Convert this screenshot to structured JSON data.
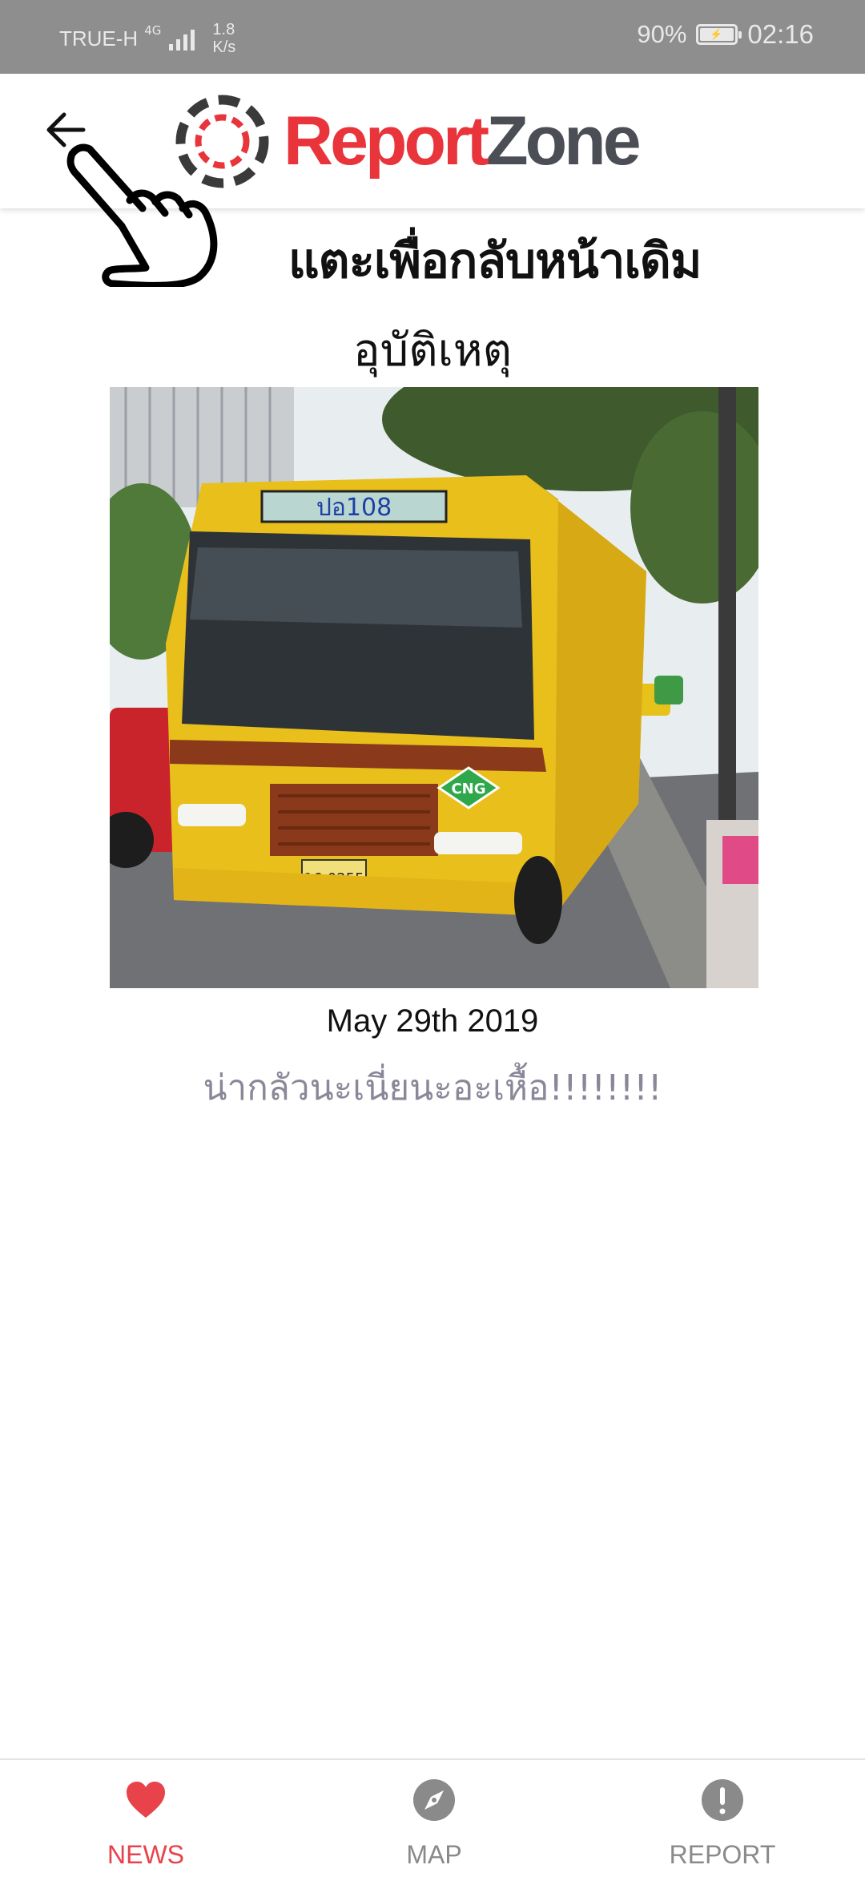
{
  "status_bar": {
    "carrier": "TRUE-H",
    "network": "4G",
    "speed_value": "1.8",
    "speed_unit": "K/s",
    "battery": "90%",
    "time": "02:16"
  },
  "header": {
    "logo_part1": "Report",
    "logo_part2": "Zone",
    "back_icon": "back-arrow-icon"
  },
  "hint": {
    "text": "แตะเพื่อกลับหน้าเดิม",
    "icon": "tap-hand-icon"
  },
  "news": {
    "title": "อุบัติเหตุ",
    "date": "May 29th 2019",
    "description": "น่ากลัวนะเนี่ยนะอะเหื้อ!!!!!!!!",
    "photo": {
      "route_sign": "ปอ108",
      "plate": "16-0255",
      "fuel_badge": "CNG"
    }
  },
  "bottom_nav": {
    "items": [
      {
        "label": "NEWS",
        "icon": "heart-icon",
        "active": true
      },
      {
        "label": "MAP",
        "icon": "compass-icon",
        "active": false
      },
      {
        "label": "REPORT",
        "icon": "alert-icon",
        "active": false
      }
    ],
    "active_color": "#e8434b",
    "inactive_color": "#8a8a8a"
  },
  "colors": {
    "status_bar": "#8e8e8e",
    "brand_red": "#e8343a",
    "brand_gray": "#4b4f55"
  }
}
